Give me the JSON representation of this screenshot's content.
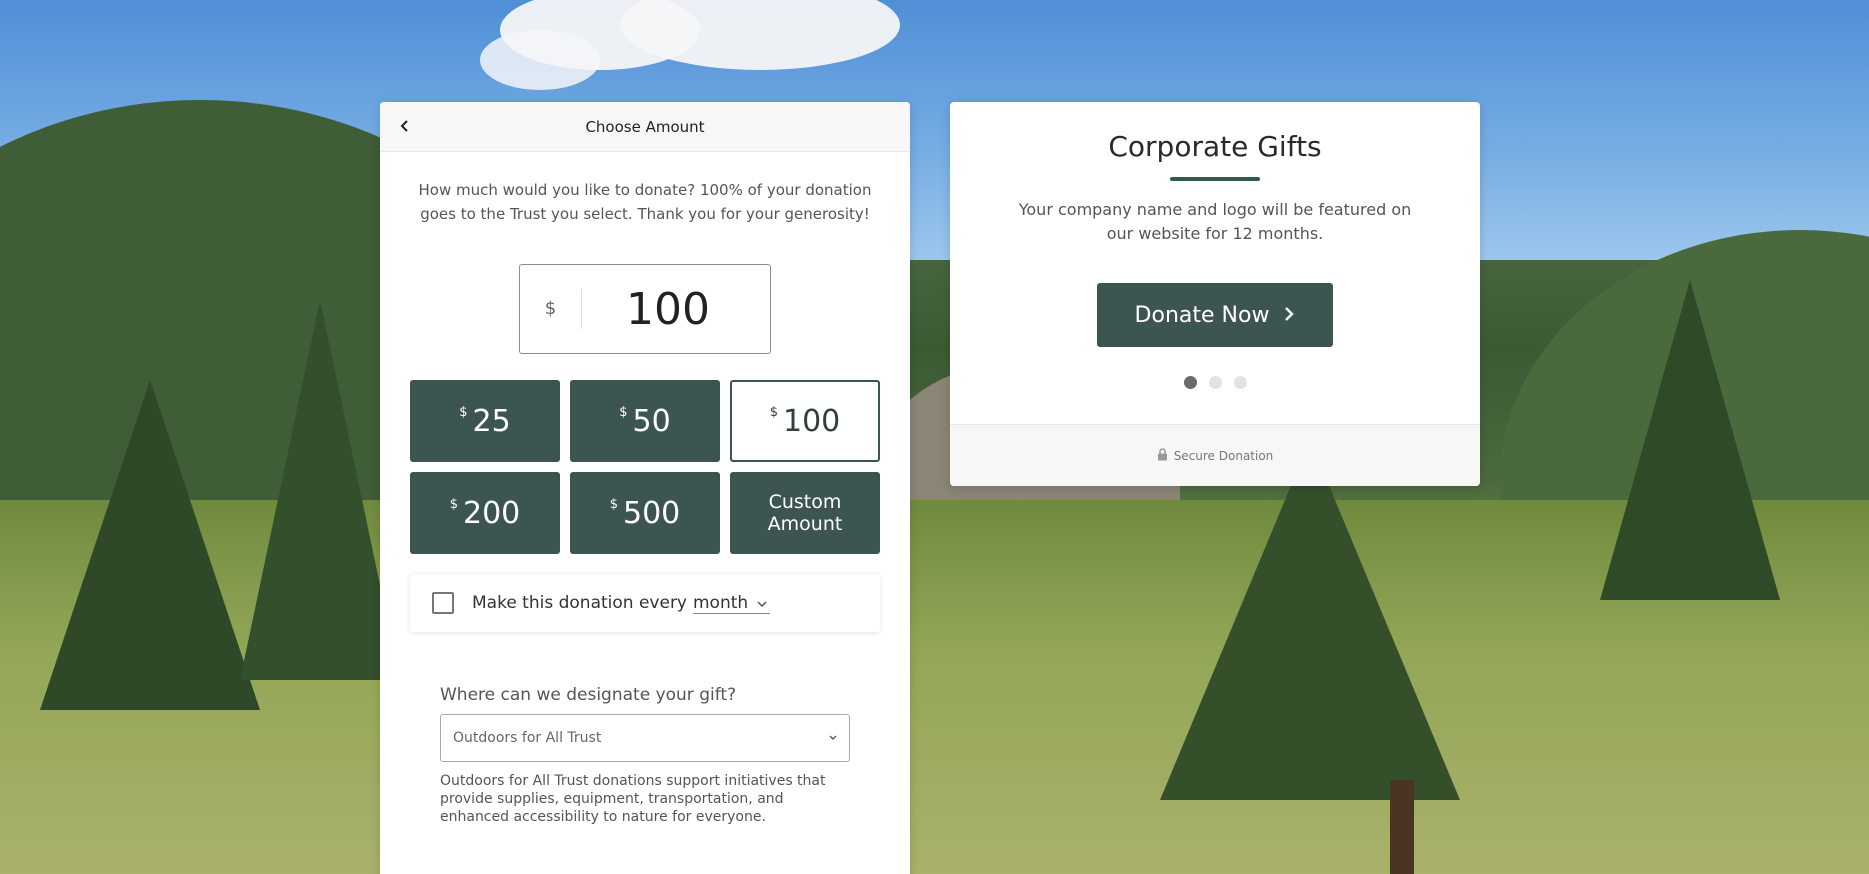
{
  "choose_amount": {
    "header_title": "Choose Amount",
    "intro_text": "How much would you like to donate? 100% of your donation goes to the Trust you select. Thank you for your generosity!",
    "amount": {
      "currency": "$",
      "value": "100"
    },
    "presets": [
      {
        "currency": "$",
        "amount": "25",
        "selected": false
      },
      {
        "currency": "$",
        "amount": "50",
        "selected": false
      },
      {
        "currency": "$",
        "amount": "100",
        "selected": true
      },
      {
        "currency": "$",
        "amount": "200",
        "selected": false
      },
      {
        "currency": "$",
        "amount": "500",
        "selected": false
      }
    ],
    "custom_amount_label": "Custom Amount",
    "recurring": {
      "text": "Make this donation every",
      "frequency": "month",
      "checked": false
    },
    "designate": {
      "label": "Where can we designate your gift?",
      "selected": "Outdoors for All Trust",
      "description": "Outdoors for All Trust donations support initiatives that provide supplies, equipment, transportation, and enhanced accessibility to nature for everyone."
    }
  },
  "corporate_gifts": {
    "title": "Corporate Gifts",
    "description": "Your company name and logo will be featured on our website for 12 months.",
    "donate_button_label": "Donate Now",
    "carousel_dots": 3,
    "active_dot": 0,
    "secure_label": "Secure Donation"
  },
  "colors": {
    "primary": "#3d5551",
    "accent_underline": "#2f5a4f"
  },
  "icons": {
    "back": "chevron-left-icon",
    "donate_chevron": "chevron-right-icon",
    "lock": "lock-icon",
    "dropdown": "chevron-down-icon"
  }
}
